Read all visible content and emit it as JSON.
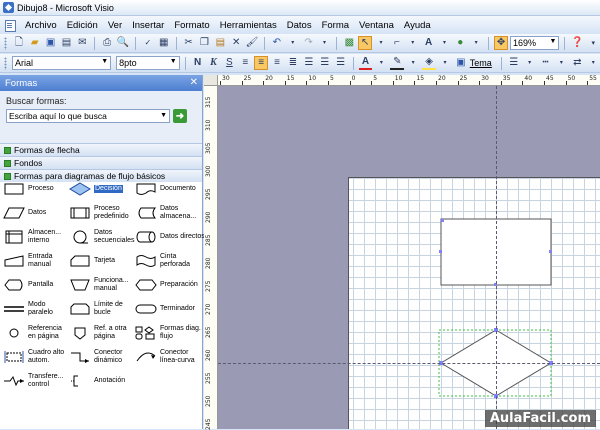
{
  "window": {
    "title": "Dibujo8 - Microsoft Visio"
  },
  "menu": [
    "Archivo",
    "Edición",
    "Ver",
    "Insertar",
    "Formato",
    "Herramientas",
    "Datos",
    "Forma",
    "Ventana",
    "Ayuda"
  ],
  "toolbar1": {
    "zoom": "169%"
  },
  "toolbar2": {
    "font": "Arial",
    "size": "8pto",
    "bold": "N",
    "italic": "K",
    "underline": "S",
    "theme": "Tema"
  },
  "pane": {
    "title": "Formas",
    "search_label": "Buscar formas:",
    "search_value": "Escriba aquí lo que busca",
    "stencils": [
      "Formas de flecha",
      "Fondos",
      "Formas para diagramas de flujo básicos"
    ],
    "shapes": [
      {
        "label": "Proceso",
        "icon": "process-rect-icon",
        "selected": false
      },
      {
        "label": "Decisión",
        "icon": "decision-diamond-icon",
        "selected": true
      },
      {
        "label": "Documento",
        "icon": "document-icon",
        "selected": false
      },
      {
        "label": "Datos",
        "icon": "data-parallelogram-icon",
        "selected": false
      },
      {
        "label": "Proceso predefinido",
        "icon": "predefined-process-icon",
        "selected": false
      },
      {
        "label": "Datos almacena...",
        "icon": "stored-data-icon",
        "selected": false
      },
      {
        "label": "Almacen... interno",
        "icon": "internal-storage-icon",
        "selected": false
      },
      {
        "label": "Datos secuenciales",
        "icon": "sequential-data-icon",
        "selected": false
      },
      {
        "label": "Datos directos",
        "icon": "direct-data-icon",
        "selected": false
      },
      {
        "label": "Entrada manual",
        "icon": "manual-input-icon",
        "selected": false
      },
      {
        "label": "Tarjeta",
        "icon": "card-icon",
        "selected": false
      },
      {
        "label": "Cinta perforada",
        "icon": "punched-tape-icon",
        "selected": false
      },
      {
        "label": "Pantalla",
        "icon": "display-icon",
        "selected": false
      },
      {
        "label": "Funciona... manual",
        "icon": "manual-operation-icon",
        "selected": false
      },
      {
        "label": "Preparación",
        "icon": "preparation-icon",
        "selected": false
      },
      {
        "label": "Modo paralelo",
        "icon": "parallel-mode-icon",
        "selected": false
      },
      {
        "label": "Límite de bucle",
        "icon": "loop-limit-icon",
        "selected": false
      },
      {
        "label": "Terminador",
        "icon": "terminator-icon",
        "selected": false
      },
      {
        "label": "Referencia en página",
        "icon": "on-page-reference-icon",
        "selected": false
      },
      {
        "label": "Ref. a otra página",
        "icon": "off-page-reference-icon",
        "selected": false
      },
      {
        "label": "Formas diag. flujo",
        "icon": "flowchart-shapes-icon",
        "selected": false
      },
      {
        "label": "Cuadro alto autom.",
        "icon": "auto-height-box-icon",
        "selected": false
      },
      {
        "label": "Conector dinámico",
        "icon": "dynamic-connector-icon",
        "selected": false
      },
      {
        "label": "Conector línea-curva",
        "icon": "line-curve-connector-icon",
        "selected": false
      },
      {
        "label": "Transfere... control",
        "icon": "control-transfer-icon",
        "selected": false
      },
      {
        "label": "Anotación",
        "icon": "annotation-icon",
        "selected": false
      }
    ]
  },
  "ruler": {
    "h_labels": [
      "30",
      "25",
      "20",
      "15",
      "10",
      "5",
      "0",
      "5",
      "10",
      "15",
      "20",
      "25",
      "30",
      "35",
      "40",
      "45",
      "50",
      "55"
    ],
    "v_labels": [
      "315",
      "310",
      "305",
      "300",
      "295",
      "290",
      "285",
      "280",
      "275",
      "270",
      "265",
      "260",
      "255",
      "250",
      "245"
    ]
  },
  "watermark": "AulaFacil.com"
}
